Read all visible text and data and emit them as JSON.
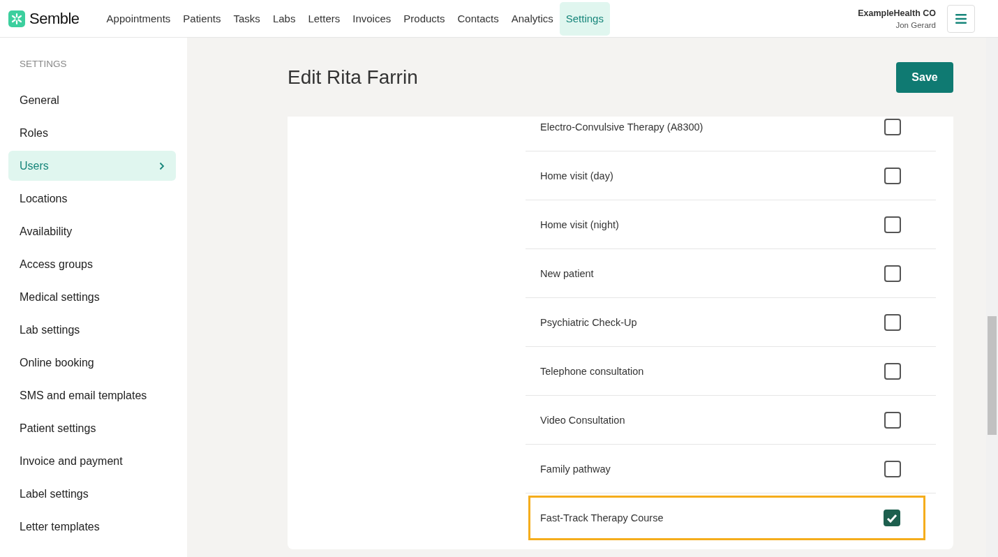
{
  "header": {
    "logo": "Semble",
    "nav": [
      {
        "label": "Appointments",
        "selected": false
      },
      {
        "label": "Patients",
        "selected": false
      },
      {
        "label": "Tasks",
        "selected": false
      },
      {
        "label": "Labs",
        "selected": false
      },
      {
        "label": "Letters",
        "selected": false
      },
      {
        "label": "Invoices",
        "selected": false
      },
      {
        "label": "Products",
        "selected": false
      },
      {
        "label": "Contacts",
        "selected": false
      },
      {
        "label": "Analytics",
        "selected": false
      },
      {
        "label": "Settings",
        "selected": true
      }
    ],
    "organisation": "ExampleHealth CO",
    "user": "Jon Gerard"
  },
  "sidebar": {
    "heading": "SETTINGS",
    "items": [
      {
        "label": "General",
        "selected": false
      },
      {
        "label": "Roles",
        "selected": false
      },
      {
        "label": "Users",
        "selected": true
      },
      {
        "label": "Locations",
        "selected": false
      },
      {
        "label": "Availability",
        "selected": false
      },
      {
        "label": "Access groups",
        "selected": false
      },
      {
        "label": "Medical settings",
        "selected": false
      },
      {
        "label": "Lab settings",
        "selected": false
      },
      {
        "label": "Online booking",
        "selected": false
      },
      {
        "label": "SMS and email templates",
        "selected": false
      },
      {
        "label": "Patient settings",
        "selected": false
      },
      {
        "label": "Invoice and payment",
        "selected": false
      },
      {
        "label": "Label settings",
        "selected": false
      },
      {
        "label": "Letter templates",
        "selected": false
      }
    ]
  },
  "page": {
    "title": "Edit Rita Farrin",
    "save_button": "Save"
  },
  "appointment_types": [
    {
      "label": "Electro-Convulsive Therapy (A8300)",
      "checked": false,
      "highlighted": false
    },
    {
      "label": "Home visit (day)",
      "checked": false,
      "highlighted": false
    },
    {
      "label": "Home visit (night)",
      "checked": false,
      "highlighted": false
    },
    {
      "label": "New patient",
      "checked": false,
      "highlighted": false
    },
    {
      "label": "Psychiatric Check-Up",
      "checked": false,
      "highlighted": false
    },
    {
      "label": "Telephone consultation",
      "checked": false,
      "highlighted": false
    },
    {
      "label": "Video Consultation",
      "checked": false,
      "highlighted": false
    },
    {
      "label": "Family pathway",
      "checked": false,
      "highlighted": false
    },
    {
      "label": "Fast-Track Therapy Course",
      "checked": true,
      "highlighted": true
    }
  ]
}
